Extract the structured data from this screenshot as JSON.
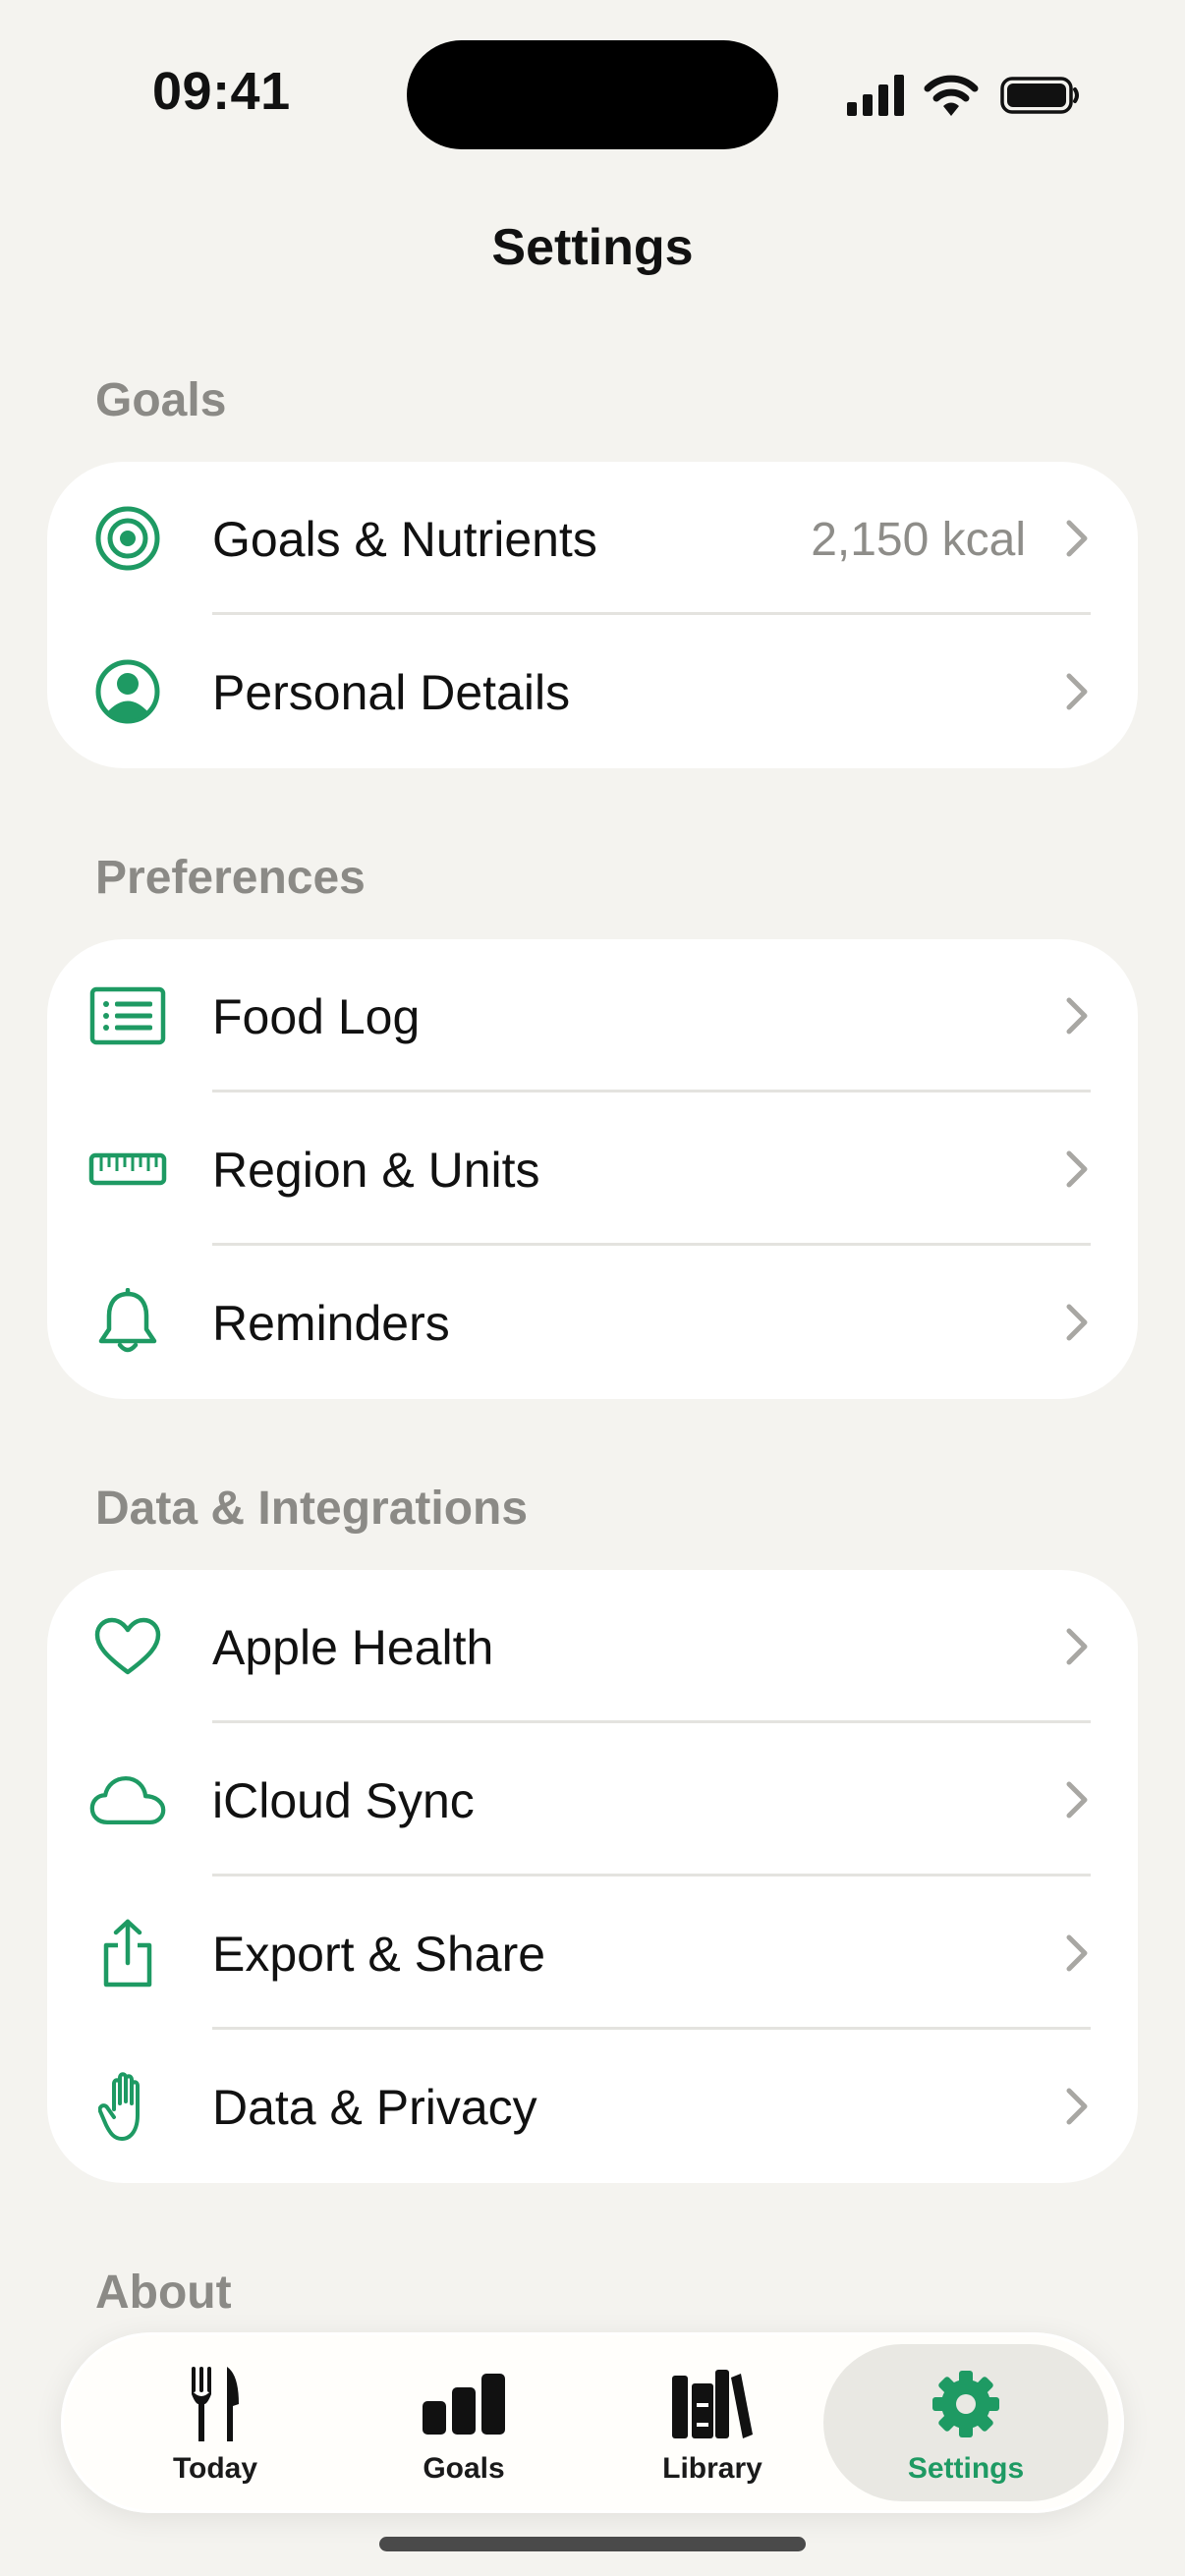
{
  "status": {
    "time": "09:41"
  },
  "title": "Settings",
  "colors": {
    "accent": "#1E9A63",
    "background": "#F4F3EF",
    "card": "#FFFFFF",
    "secondary_text": "#8E8D89"
  },
  "sections": [
    {
      "header": "Goals",
      "rows": [
        {
          "icon": "target-icon",
          "label": "Goals & Nutrients",
          "value": "2,150 kcal"
        },
        {
          "icon": "person-circle-icon",
          "label": "Personal Details"
        }
      ]
    },
    {
      "header": "Preferences",
      "rows": [
        {
          "icon": "list-icon",
          "label": "Food Log"
        },
        {
          "icon": "ruler-icon",
          "label": "Region & Units"
        },
        {
          "icon": "bell-icon",
          "label": "Reminders"
        }
      ]
    },
    {
      "header": "Data & Integrations",
      "rows": [
        {
          "icon": "heart-icon",
          "label": "Apple Health"
        },
        {
          "icon": "cloud-icon",
          "label": "iCloud Sync"
        },
        {
          "icon": "share-icon",
          "label": "Export & Share"
        },
        {
          "icon": "hand-icon",
          "label": "Data & Privacy"
        }
      ]
    },
    {
      "header": "About"
    }
  ],
  "tabs": [
    {
      "icon": "fork-knife-icon",
      "label": "Today"
    },
    {
      "icon": "bar-chart-icon",
      "label": "Goals"
    },
    {
      "icon": "books-icon",
      "label": "Library"
    },
    {
      "icon": "gear-icon",
      "label": "Settings",
      "active": true
    }
  ]
}
